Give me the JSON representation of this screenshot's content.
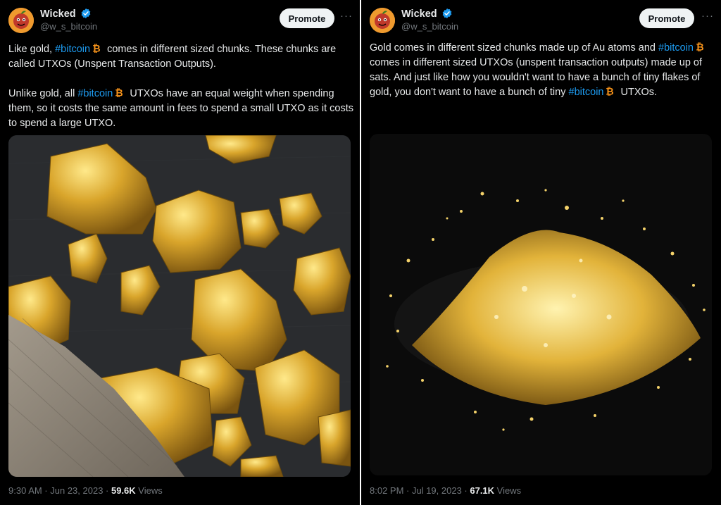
{
  "tweets": [
    {
      "author": {
        "name": "Wicked",
        "handle": "@w_s_bitcoin"
      },
      "promote_label": "Promote",
      "more_label": "···",
      "body_segments": [
        [
          {
            "text": "Like gold, "
          },
          {
            "text": "#bitcoin",
            "type": "hashtag"
          },
          {
            "icon": "bitcoin-icon"
          },
          {
            "text": " comes in different sized chunks. These chunks are called UTXOs (Unspent Transaction Outputs)."
          }
        ],
        [
          {
            "text": "Unlike gold, all "
          },
          {
            "text": "#bitcoin",
            "type": "hashtag"
          },
          {
            "icon": "bitcoin-icon"
          },
          {
            "text": " UTXOs have an equal weight when spending them, so it costs the same amount in fees to spend a small UTXO as it costs to spend a large UTXO."
          }
        ]
      ],
      "image": {
        "subject": "gold nuggets with burlap sack"
      },
      "timestamp": "9:30 AM · Jun 23, 2023 · ",
      "views_count": "59.6K",
      "views_label": " Views"
    },
    {
      "author": {
        "name": "Wicked",
        "handle": "@w_s_bitcoin"
      },
      "promote_label": "Promote",
      "more_label": "···",
      "body_segments": [
        [
          {
            "text": "Gold comes in different sized chunks made up of Au atoms and "
          },
          {
            "text": "#bitcoin",
            "type": "hashtag"
          },
          {
            "icon": "bitcoin-icon"
          },
          {
            "text": " comes in different sized UTXOs (unspent transaction outputs) made up of sats. And just like how you wouldn't want to have a bunch of tiny flakes of gold, you don't want to have a bunch of tiny "
          },
          {
            "text": "#bitcoin",
            "type": "hashtag"
          },
          {
            "icon": "bitcoin-icon"
          },
          {
            "text": " UTXOs."
          }
        ]
      ],
      "image": {
        "subject": "pile of gold flakes"
      },
      "timestamp": "8:02 PM · Jul 19, 2023 · ",
      "views_count": "67.1K",
      "views_label": " Views"
    }
  ],
  "colors": {
    "background": "#000000",
    "text": "#e7e9ea",
    "muted": "#71767b",
    "link": "#1d9bf0",
    "bitcoin": "#f7931a",
    "verified": "#1d9bf0",
    "gold": "#d4a62a"
  }
}
